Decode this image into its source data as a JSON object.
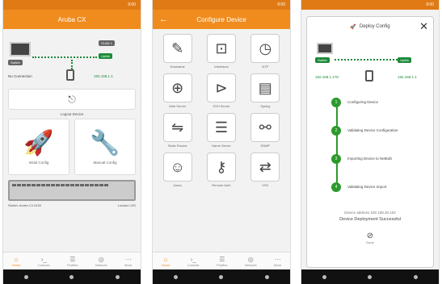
{
  "phone1": {
    "status_time": "9:00",
    "title": "Aruba CX",
    "topology": {
      "switch_tag": "Switch",
      "uplink_tag": "Uplink",
      "vlan_tag": "VLAN 1",
      "no_connection": "No Connection",
      "ip_label": "192.168.1.1"
    },
    "logout_section_label": "Logout Device",
    "tiles": [
      {
        "label": "Initial Config"
      },
      {
        "label": "Manual Config"
      }
    ],
    "device_info": {
      "left": "Switch: Aruba CX 6100",
      "right": "Locator LED"
    }
  },
  "phone2": {
    "status_time": "9:00",
    "title": "Configure Device",
    "tiles": [
      {
        "label": "Hostname",
        "icon": "pencil-icon"
      },
      {
        "label": "Interfaces",
        "icon": "ethernet-icon"
      },
      {
        "label": "NTP",
        "icon": "clock-icon"
      },
      {
        "label": "Web Server",
        "icon": "globe-icon"
      },
      {
        "label": "SSH Server",
        "icon": "terminal-icon"
      },
      {
        "label": "Syslog",
        "icon": "clipboard-icon"
      },
      {
        "label": "Static Routes",
        "icon": "signpost-icon"
      },
      {
        "label": "Name Server",
        "icon": "server-icon"
      },
      {
        "label": "SNMP",
        "icon": "network-icon"
      },
      {
        "label": "Users",
        "icon": "users-icon"
      },
      {
        "label": "Remote Auth",
        "icon": "key-icon"
      },
      {
        "label": "VSX",
        "icon": "exchange-icon"
      }
    ]
  },
  "phone3": {
    "status_time": "9:00",
    "title": "Deploy Config",
    "topology": {
      "left_tag": "Switch",
      "right_tag": "Uplink",
      "ip_label": "192.168.1.178",
      "ip_label2": "192.168.1.1"
    },
    "steps": [
      {
        "num": "1",
        "label": "Configuring Device"
      },
      {
        "num": "2",
        "label": "Validating Device Configuration"
      },
      {
        "num": "3",
        "label": "Importing Device to NetEdit"
      },
      {
        "num": "4",
        "label": "Validating Device Import"
      }
    ],
    "summary_addr": "Device address 192.168.30.102",
    "summary_result": "Device Deployment Successful",
    "done_label": "Done"
  },
  "bottom_nav": [
    {
      "label": "Home",
      "icon": "home-icon"
    },
    {
      "label": "Console",
      "icon": "console-icon"
    },
    {
      "label": "Profiles",
      "icon": "profiles-icon"
    },
    {
      "label": "Network",
      "icon": "network-icon"
    },
    {
      "label": "More",
      "icon": "more-icon"
    }
  ],
  "colors": {
    "accent": "#f08c1e",
    "success": "#1b8a3a"
  }
}
